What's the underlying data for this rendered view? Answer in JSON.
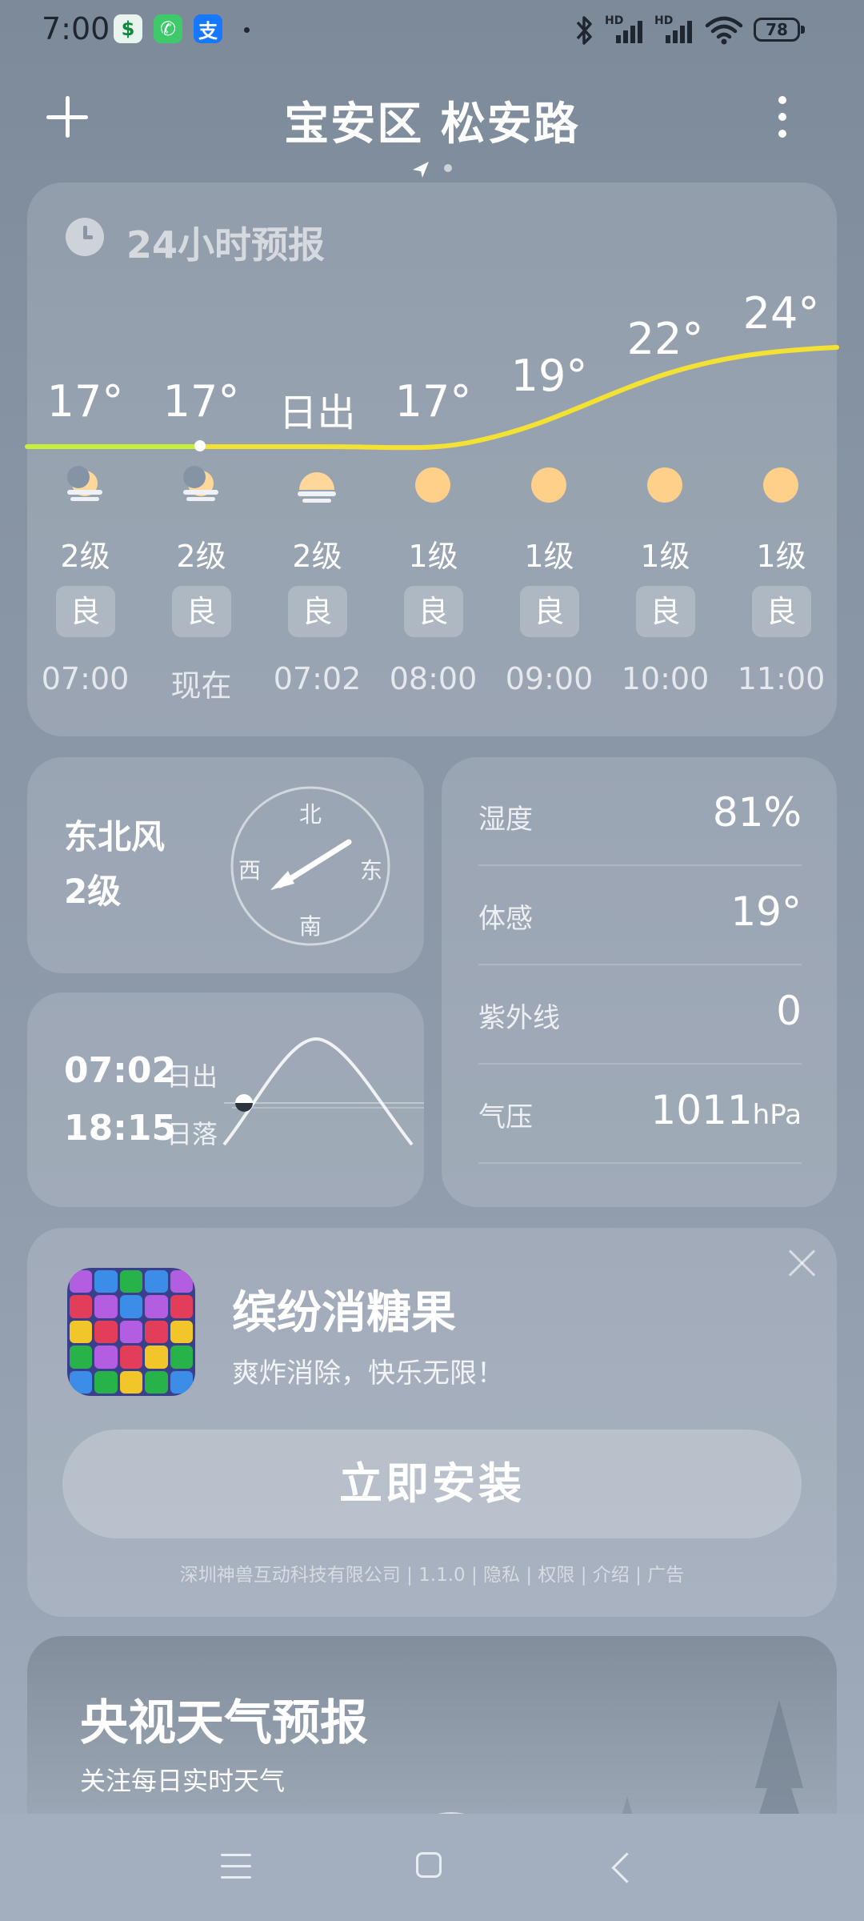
{
  "status_bar": {
    "time": "7:00",
    "battery": "78",
    "app_icons": [
      "finance-app-icon",
      "phone-app-icon",
      "alipay-app-icon"
    ],
    "right_icons": [
      "bluetooth-icon",
      "hd-signal-icon",
      "hd-signal-icon",
      "wifi-icon"
    ],
    "hd_label": "HD"
  },
  "header": {
    "location": "宝安区 松安路",
    "add_icon": "plus-icon",
    "menu_icon": "more-vertical-icon"
  },
  "forecast": {
    "title": "24小时预报",
    "line_colors": {
      "past": "#c9ef3c",
      "future": "#f3e233"
    },
    "items": [
      {
        "temp": "17°",
        "weather_icon": "moon-cloud-icon",
        "wind": "2级",
        "aqi": "良",
        "time": "07:00"
      },
      {
        "temp": "17°",
        "weather_icon": "moon-cloud-icon",
        "wind": "2级",
        "aqi": "良",
        "time": "现在"
      },
      {
        "temp": "日出",
        "weather_icon": "sunrise-icon",
        "wind": "2级",
        "aqi": "良",
        "time": "07:02"
      },
      {
        "temp": "17°",
        "weather_icon": "sun-icon",
        "wind": "1级",
        "aqi": "良",
        "time": "08:00"
      },
      {
        "temp": "19°",
        "weather_icon": "sun-icon",
        "wind": "1级",
        "aqi": "良",
        "time": "09:00"
      },
      {
        "temp": "22°",
        "weather_icon": "sun-icon",
        "wind": "1级",
        "aqi": "良",
        "time": "10:00"
      },
      {
        "temp": "24°",
        "weather_icon": "sun-icon",
        "wind": "1级",
        "aqi": "良",
        "time": "11:00"
      }
    ]
  },
  "wind": {
    "direction": "东北风",
    "level": "2级",
    "compass": {
      "n": "北",
      "s": "南",
      "e": "东",
      "w": "西"
    }
  },
  "details": [
    {
      "label": "湿度",
      "value": "81%",
      "unit": ""
    },
    {
      "label": "体感",
      "value": "19°",
      "unit": ""
    },
    {
      "label": "紫外线",
      "value": "0",
      "unit": ""
    },
    {
      "label": "气压",
      "value": "1011",
      "unit": "hPa"
    }
  ],
  "sun": {
    "sunrise_time": "07:02",
    "sunrise_label": "日出",
    "sunset_time": "18:15",
    "sunset_label": "日落"
  },
  "ad": {
    "title": "缤纷消糖果",
    "subtitle": "爽炸消除，快乐无限！",
    "button": "立即安装",
    "meta": "深圳神兽互动科技有限公司 | 1.1.0 | 隐私 | 权限 | 介绍 | 广告",
    "close_icon": "close-icon"
  },
  "cctv": {
    "title": "央视天气预报",
    "subtitle": "关注每日实时天气"
  },
  "navbar": {
    "icons": [
      "menu-icon",
      "home-icon",
      "back-icon"
    ]
  }
}
